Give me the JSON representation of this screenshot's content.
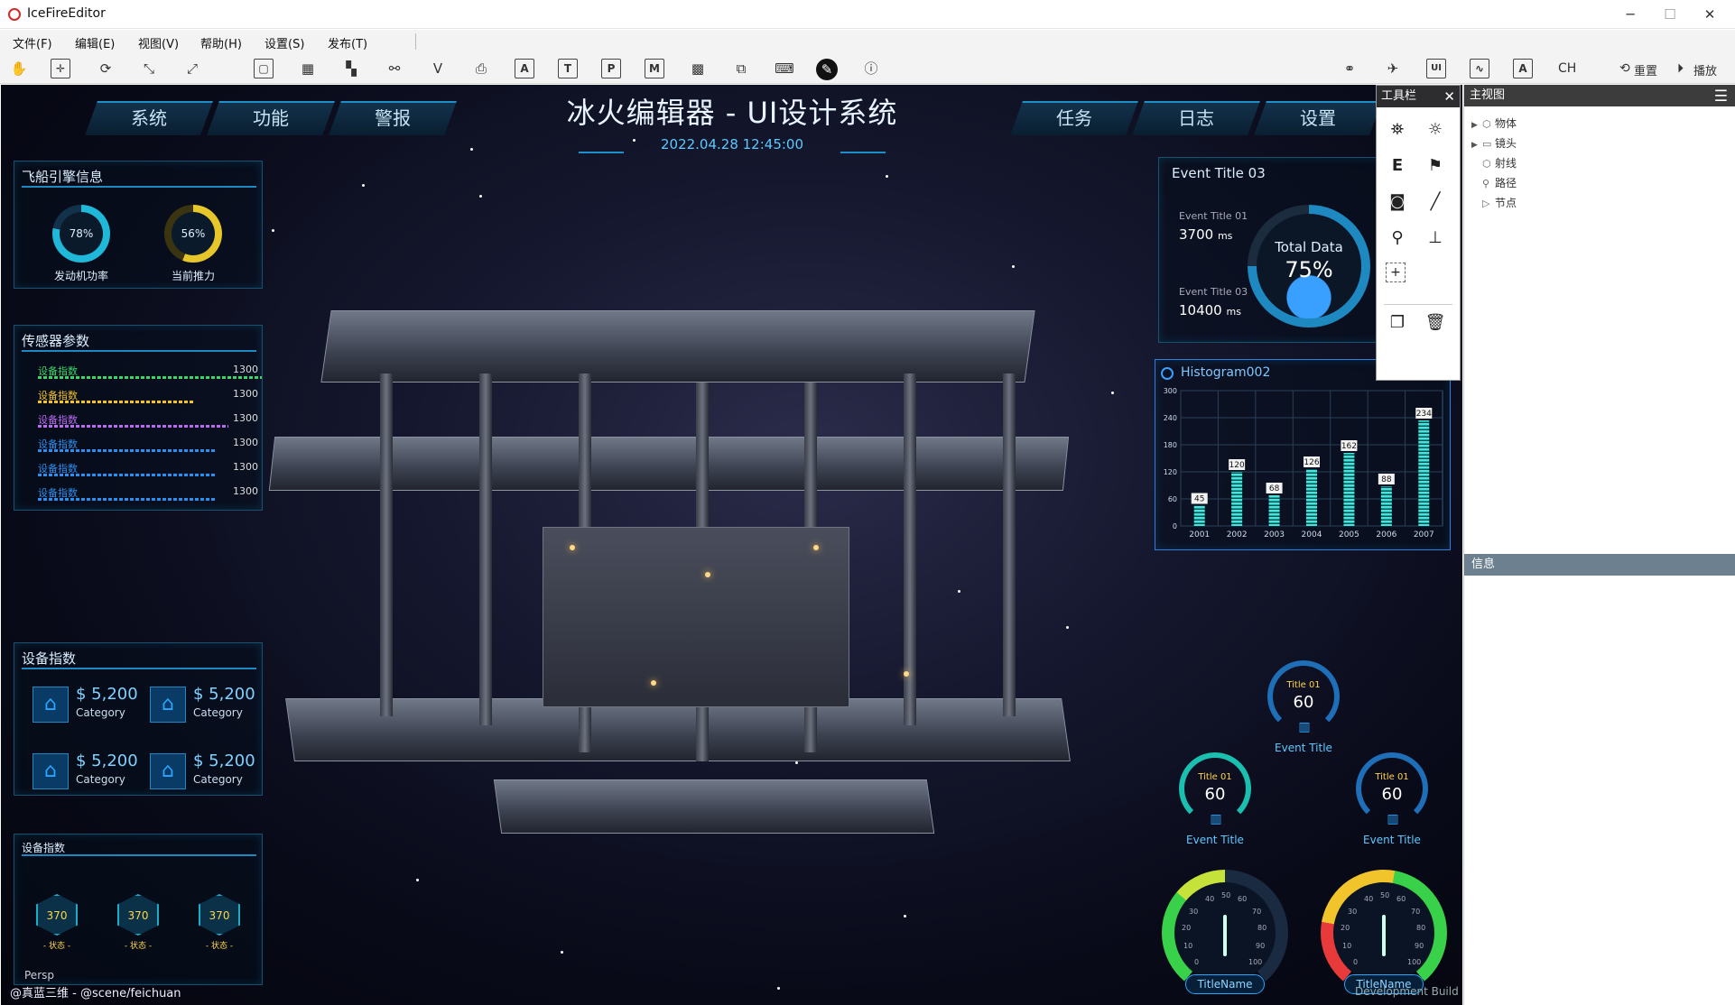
{
  "window": {
    "title": "IceFireEditor"
  },
  "menu": [
    "文件(F)",
    "编辑(E)",
    "视图(V)",
    "帮助(H)",
    "设置(S)",
    "发布(T)"
  ],
  "toolbar": {
    "ch": "CH",
    "reset": "重置",
    "play": "播放"
  },
  "hud": {
    "title": "冰火编辑器 - UI设计系统",
    "datetime": "2022.04.28 12:45:00",
    "nav_left": [
      "系统",
      "功能",
      "警报"
    ],
    "nav_right": [
      "任务",
      "日志",
      "设置"
    ]
  },
  "engine": {
    "title": "飞船引擎信息",
    "gauges": [
      {
        "value": "78%",
        "label": "发动机功率",
        "color": "#1fb8d8"
      },
      {
        "value": "56%",
        "label": "当前推力",
        "color": "#e6c62a"
      }
    ]
  },
  "sensors": {
    "title": "传感器参数",
    "rows": [
      {
        "name": "设备指数",
        "value": "1300",
        "color": "#3fd46a",
        "fill": 1.0
      },
      {
        "name": "设备指数",
        "value": "1300",
        "color": "#f2c22c",
        "fill": 0.7
      },
      {
        "name": "设备指数",
        "value": "1300",
        "color": "#b86cf0",
        "fill": 0.85
      },
      {
        "name": "设备指数",
        "value": "1300",
        "color": "#2e8ff0",
        "fill": 0.8
      },
      {
        "name": "设备指数",
        "value": "1300",
        "color": "#2e8ff0",
        "fill": 0.8
      },
      {
        "name": "设备指数",
        "value": "1300",
        "color": "#2e8ff0",
        "fill": 0.8
      }
    ]
  },
  "devices": {
    "title": "设备指数",
    "items": [
      {
        "value": "$ 5,200",
        "category": "Category"
      },
      {
        "value": "$ 5,200",
        "category": "Category"
      },
      {
        "value": "$ 5,200",
        "category": "Category"
      },
      {
        "value": "$ 5,200",
        "category": "Category"
      }
    ]
  },
  "devices2": {
    "title": "设备指数",
    "items": [
      {
        "value": "370",
        "status": "- 状态 -"
      },
      {
        "value": "370",
        "status": "- 状态 -"
      },
      {
        "value": "370",
        "status": "- 状态 -"
      }
    ]
  },
  "event": {
    "title": "Event Title 03",
    "left": [
      {
        "label": "Event Title 01",
        "value": "3700",
        "unit": "ms"
      },
      {
        "label": "Event Title 03",
        "value": "10400",
        "unit": "ms"
      }
    ],
    "center_label": "Total Data",
    "center_value": "75%"
  },
  "histogram": {
    "title": "Histogram002"
  },
  "chart_data": {
    "type": "bar",
    "title": "Histogram002",
    "categories": [
      "2001",
      "2002",
      "2003",
      "2004",
      "2005",
      "2006",
      "2007"
    ],
    "values": [
      45,
      120,
      68,
      126,
      162,
      88,
      234
    ],
    "ylim": [
      0,
      300
    ],
    "yticks": [
      "0",
      "60",
      "120",
      "180",
      "240",
      "300"
    ]
  },
  "mini_gauges": [
    {
      "title": "Title 01",
      "value": "60",
      "label": "Event Title"
    },
    {
      "title": "Title 01",
      "value": "60",
      "label": "Event Title"
    },
    {
      "title": "Title 01",
      "value": "60",
      "label": "Event Title"
    }
  ],
  "speedometers": [
    {
      "name": "TitleName",
      "ticks": [
        "0",
        "10",
        "20",
        "30",
        "40",
        "50",
        "60",
        "70",
        "80",
        "90",
        "100"
      ]
    },
    {
      "name": "TitleName",
      "ticks": [
        "0",
        "10",
        "20",
        "30",
        "40",
        "50",
        "60",
        "70",
        "80",
        "90",
        "100"
      ]
    }
  ],
  "viewport": {
    "persp": "Persp",
    "credit": "@真蓝三维 - @scene/feichuan",
    "build": "Development Build"
  },
  "toolpanel": {
    "title": "工具栏"
  },
  "outline": {
    "title": "主视图",
    "items": [
      {
        "label": "物体",
        "arrow": "▶"
      },
      {
        "label": "镜头",
        "arrow": "▶"
      },
      {
        "label": "射线",
        "arrow": ""
      },
      {
        "label": "路径",
        "arrow": ""
      },
      {
        "label": "节点",
        "arrow": ""
      }
    ]
  },
  "info": {
    "title": "信息"
  }
}
